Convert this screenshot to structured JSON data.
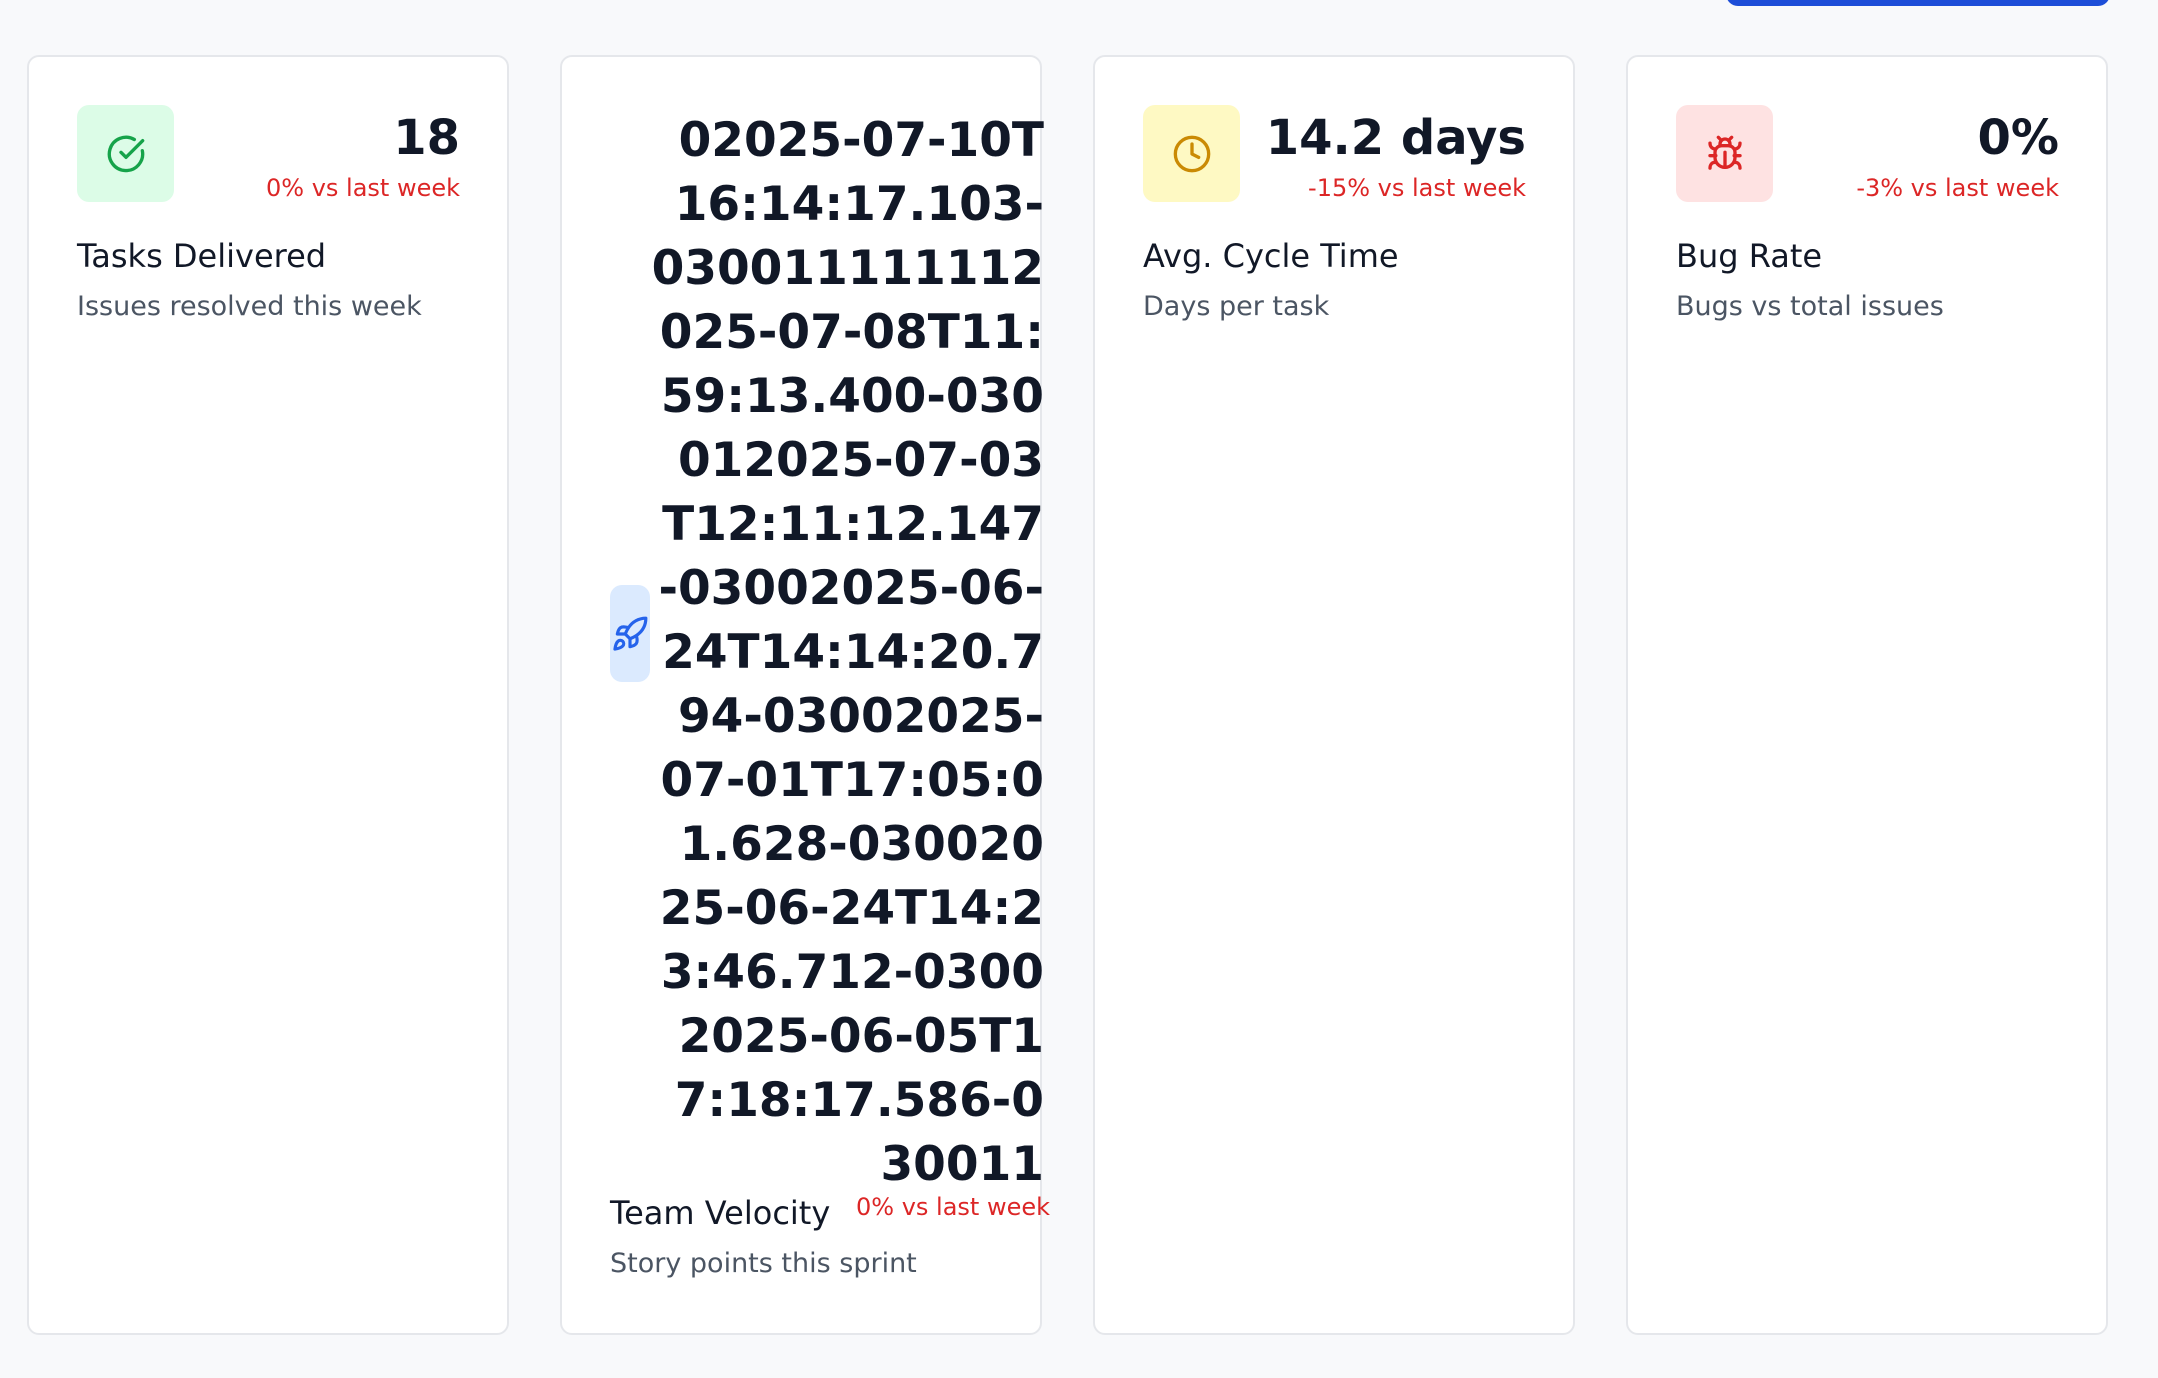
{
  "cards": [
    {
      "value": "18",
      "change": "0% vs last week",
      "title": "Tasks Delivered",
      "subtitle": "Issues resolved this week",
      "icon": "check-circle-icon",
      "accent": "#16a34a"
    },
    {
      "value": "02025-07-10T16:14:17.103-030011111112025-07-08T11:59:13.400-030012025-07-03T12:11:12.147-03002025-06-24T14:14:20.794-03002025-07-01T17:05:01.628-03002025-06-24T14:23:46.712-03002025-06-05T17:18:17.586-030011",
      "change": "0% vs last week",
      "title": "Team Velocity",
      "subtitle": "Story points this sprint",
      "icon": "rocket-icon",
      "accent": "#2563eb"
    },
    {
      "value": "14.2 days",
      "change": "-15% vs last week",
      "title": "Avg. Cycle Time",
      "subtitle": "Days per task",
      "icon": "clock-icon",
      "accent": "#ca8a04"
    },
    {
      "value": "0%",
      "change": "-3% vs last week",
      "title": "Bug Rate",
      "subtitle": "Bugs vs total issues",
      "icon": "bug-icon",
      "accent": "#dc2626"
    }
  ],
  "colors": {
    "negative": "#dc2626",
    "primary_button": "#1d4ed8"
  }
}
